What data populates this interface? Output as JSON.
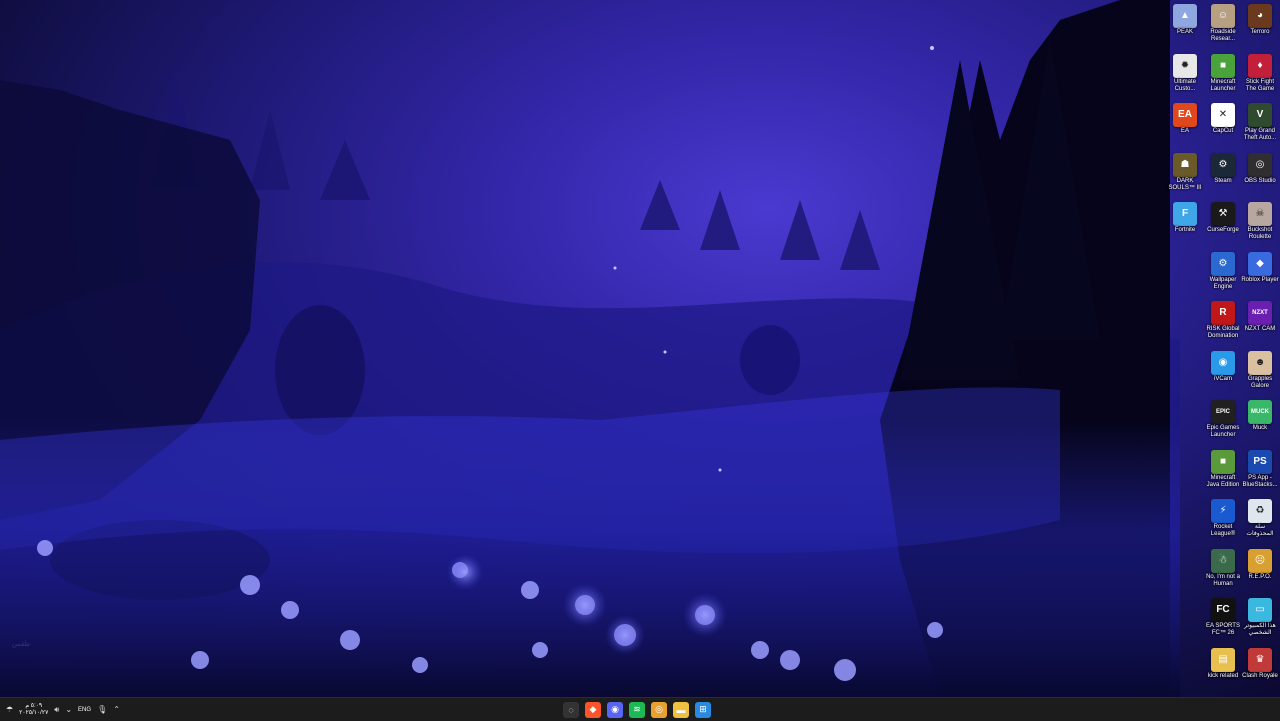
{
  "desktop": {
    "faint_label": "طقس"
  },
  "icons": [
    {
      "label": "PEAK",
      "glyph": "▲",
      "bg": "#8fa6e0",
      "col": 2,
      "row": 0
    },
    {
      "label": "Roadside Resear...",
      "glyph": "☺",
      "bg": "#b7a081",
      "col": 1,
      "row": 0
    },
    {
      "label": "Terroro",
      "glyph": "◕",
      "bg": "#6b3a1e",
      "col": 0,
      "row": 0
    },
    {
      "label": "Ultimate Custo...",
      "glyph": "✹",
      "bg": "#e8e8e8",
      "col": 2,
      "row": 1
    },
    {
      "label": "Minecraft Launcher",
      "glyph": "■",
      "bg": "#4aa33a",
      "col": 1,
      "row": 1
    },
    {
      "label": "Stick Fight The Game",
      "glyph": "♦",
      "bg": "#c21f3a",
      "col": 0,
      "row": 1
    },
    {
      "label": "EA",
      "glyph": "EA",
      "bg": "#e0471c",
      "col": 2,
      "row": 2
    },
    {
      "label": "CapCut",
      "glyph": "✕",
      "bg": "#ffffff",
      "col": 1,
      "row": 2
    },
    {
      "label": "Play Grand Theft Auto...",
      "glyph": "V",
      "bg": "#2f4a2f",
      "col": 0,
      "row": 2
    },
    {
      "label": "DARK SOULS™ III",
      "glyph": "☗",
      "bg": "#6a5a2a",
      "col": 2,
      "row": 3
    },
    {
      "label": "Steam",
      "glyph": "⚙",
      "bg": "#1b2838",
      "col": 1,
      "row": 3
    },
    {
      "label": "OBS Studio",
      "glyph": "◎",
      "bg": "#302e31",
      "col": 0,
      "row": 3
    },
    {
      "label": "Fortnite",
      "glyph": "F",
      "bg": "#3fa7e8",
      "col": 2,
      "row": 4
    },
    {
      "label": "CurseForge",
      "glyph": "⚒",
      "bg": "#1a1a1a",
      "col": 1,
      "row": 4
    },
    {
      "label": "Buckshot Roulette",
      "glyph": "☠",
      "bg": "#b8a7a0",
      "col": 0,
      "row": 4
    },
    {
      "label": "Wallpaper Engine",
      "glyph": "⚙",
      "bg": "#2a6ad0",
      "col": 1,
      "row": 5
    },
    {
      "label": "Roblox Player",
      "glyph": "◆",
      "bg": "#3a6ae0",
      "col": 0,
      "row": 5
    },
    {
      "label": "RISK Global Domination",
      "glyph": "R",
      "bg": "#c01818",
      "col": 1,
      "row": 6
    },
    {
      "label": "NZXT CAM",
      "glyph": "NZXT",
      "bg": "#6a1fb0",
      "col": 0,
      "row": 6
    },
    {
      "label": "iVCam",
      "glyph": "◉",
      "bg": "#2a9ae8",
      "col": 1,
      "row": 7
    },
    {
      "label": "Grapples Galore",
      "glyph": "☻",
      "bg": "#d8c0a0",
      "col": 0,
      "row": 7
    },
    {
      "label": "Epic Games Launcher",
      "glyph": "EPIC",
      "bg": "#202020",
      "col": 1,
      "row": 8
    },
    {
      "label": "Muck",
      "glyph": "MUCK",
      "bg": "#3ab86a",
      "col": 0,
      "row": 8
    },
    {
      "label": "Minecraft Java Edition",
      "glyph": "■",
      "bg": "#5a9a3a",
      "col": 1,
      "row": 9
    },
    {
      "label": "PS App - BlueStacks...",
      "glyph": "PS",
      "bg": "#1a4ab0",
      "col": 0,
      "row": 9
    },
    {
      "label": "Rocket League®",
      "glyph": "⚡",
      "bg": "#1a5ad0",
      "col": 1,
      "row": 10
    },
    {
      "label": "سلة المحذوفات",
      "glyph": "♻",
      "bg": "#dfe6ee",
      "col": 0,
      "row": 10
    },
    {
      "label": "No, I'm not a Human",
      "glyph": "☃",
      "bg": "#3a6a4a",
      "col": 1,
      "row": 11
    },
    {
      "label": "R.E.P.O.",
      "glyph": "☹",
      "bg": "#d8a030",
      "col": 0,
      "row": 11
    },
    {
      "label": "EA SPORTS FC™ 26",
      "glyph": "FC",
      "bg": "#111111",
      "col": 1,
      "row": 12
    },
    {
      "label": "هذا الكمبيوتر الشخصي",
      "glyph": "▭",
      "bg": "#3ab8e0",
      "col": 0,
      "row": 12
    },
    {
      "label": "kick related",
      "glyph": "▤",
      "bg": "#e8c050",
      "col": 1,
      "row": 13
    },
    {
      "label": "Clash Royale",
      "glyph": "♛",
      "bg": "#c03a3a",
      "col": 0,
      "row": 13
    }
  ],
  "taskbar": {
    "time": "٥:٠٩ م",
    "date": "٢٠٢٥/١٠/٢٧",
    "lang": "ENG",
    "apps": [
      {
        "name": "search-app",
        "glyph": "◌",
        "bg": "#333333"
      },
      {
        "name": "brave-app",
        "glyph": "◆",
        "bg": "#fb542b"
      },
      {
        "name": "discord-app",
        "glyph": "◉",
        "bg": "#5865f2"
      },
      {
        "name": "spotify-app",
        "glyph": "≋",
        "bg": "#1db954"
      },
      {
        "name": "chrome-app",
        "glyph": "◎",
        "bg": "#e8a030"
      },
      {
        "name": "file-explorer-app",
        "glyph": "▬",
        "bg": "#f0c040"
      },
      {
        "name": "start-app",
        "glyph": "⊞",
        "bg": "#2a8ae0"
      }
    ]
  }
}
